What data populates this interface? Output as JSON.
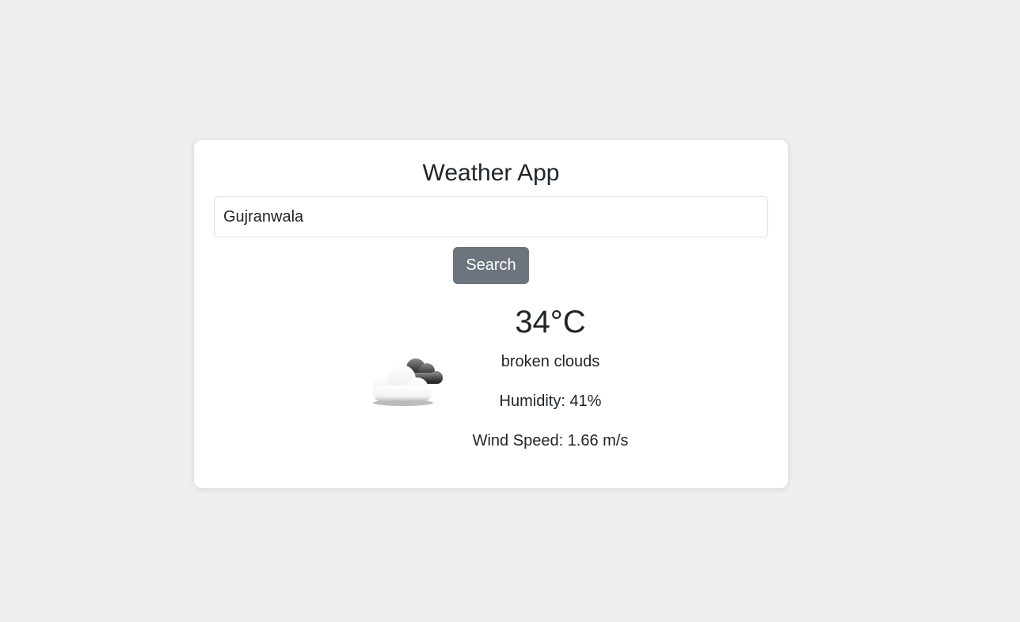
{
  "app": {
    "title": "Weather App"
  },
  "search": {
    "value": "Gujranwala",
    "button_label": "Search"
  },
  "weather": {
    "icon": "broken-clouds-icon",
    "temperature": "34°C",
    "description": "broken clouds",
    "humidity": "Humidity: 41%",
    "wind_speed": "Wind Speed: 1.66 m/s"
  },
  "colors": {
    "background": "#efefef",
    "card": "#ffffff",
    "button": "#6c757d",
    "text": "#212529"
  }
}
